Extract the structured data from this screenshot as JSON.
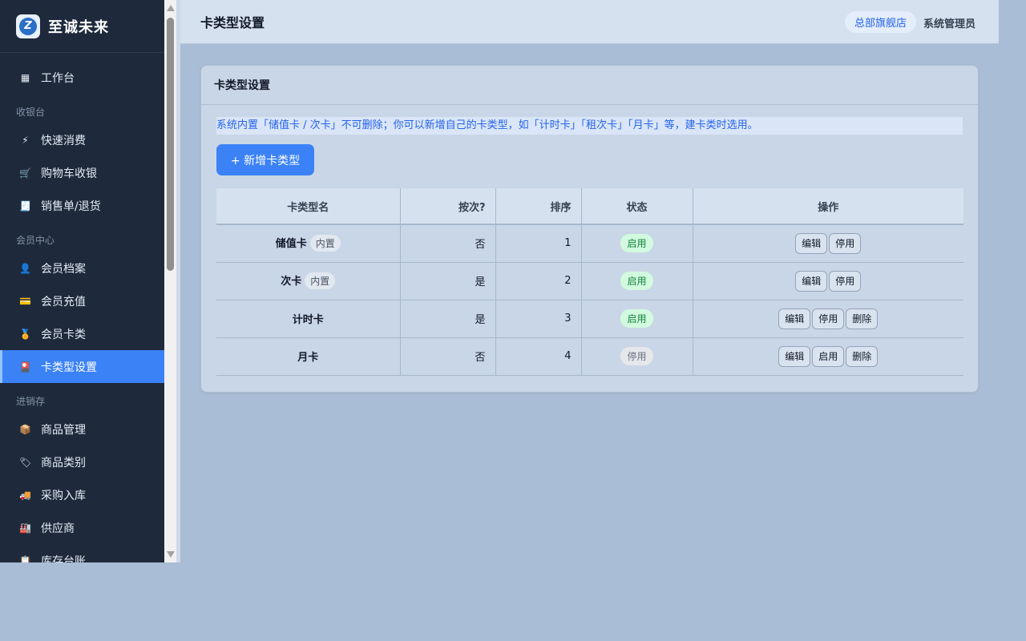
{
  "brand": {
    "name": "至诚未来",
    "logo_letter": "Z"
  },
  "sidebar": {
    "items": [
      {
        "icon": "▦",
        "label": "工作台",
        "type": "item"
      },
      {
        "label": "收银台",
        "type": "group"
      },
      {
        "icon": "⚡",
        "label": "快速消费",
        "type": "item"
      },
      {
        "icon": "🛒",
        "label": "购物车收银",
        "type": "item"
      },
      {
        "icon": "🧾",
        "label": "销售单/退货",
        "type": "item"
      },
      {
        "label": "会员中心",
        "type": "group"
      },
      {
        "icon": "👤",
        "label": "会员档案",
        "type": "item"
      },
      {
        "icon": "💳",
        "label": "会员充值",
        "type": "item"
      },
      {
        "icon": "🏅",
        "label": "会员卡类",
        "type": "item"
      },
      {
        "icon": "🎴",
        "label": "卡类型设置",
        "type": "item",
        "active": true
      },
      {
        "label": "进销存",
        "type": "group"
      },
      {
        "icon": "📦",
        "label": "商品管理",
        "type": "item"
      },
      {
        "icon": "🏷",
        "label": "商品类别",
        "type": "item"
      },
      {
        "icon": "🚚",
        "label": "采购入库",
        "type": "item"
      },
      {
        "icon": "🏭",
        "label": "供应商",
        "type": "item"
      },
      {
        "icon": "📋",
        "label": "库存台账",
        "type": "item"
      }
    ]
  },
  "header": {
    "title": "卡类型设置",
    "store": "总部旗舰店",
    "user": "系统管理员"
  },
  "card": {
    "title": "卡类型设置",
    "notice": "系统内置「储值卡 / 次卡」不可删除；你可以新增自己的卡类型，如「计时卡」「租次卡」「月卡」等，建卡类时选用。",
    "add_button": "+ 新增卡类型"
  },
  "table": {
    "columns": [
      "卡类型名",
      "按次?",
      "排序",
      "状态",
      "操作"
    ],
    "rows": [
      {
        "name": "储值卡",
        "tag": "内置",
        "by_count": "否",
        "sort": "1",
        "status": "启用",
        "status_on": true,
        "ops": [
          "编辑",
          "停用"
        ]
      },
      {
        "name": "次卡",
        "tag": "内置",
        "by_count": "是",
        "sort": "2",
        "status": "启用",
        "status_on": true,
        "ops": [
          "编辑",
          "停用"
        ]
      },
      {
        "name": "计时卡",
        "tag": "",
        "by_count": "是",
        "sort": "3",
        "status": "启用",
        "status_on": true,
        "ops": [
          "编辑",
          "停用",
          "删除"
        ]
      },
      {
        "name": "月卡",
        "tag": "",
        "by_count": "否",
        "sort": "4",
        "status": "停用",
        "status_on": false,
        "ops": [
          "编辑",
          "启用",
          "删除"
        ]
      }
    ]
  },
  "colors": {
    "accent": "#3b82f6",
    "sidebar_bg": "#1e2a3c",
    "status_on": "#15803d"
  }
}
